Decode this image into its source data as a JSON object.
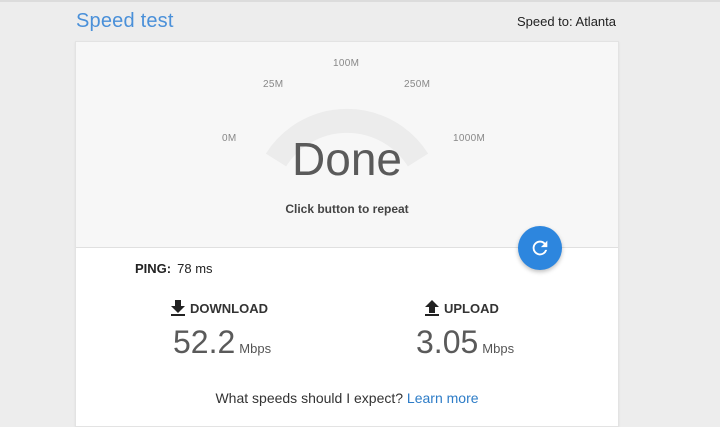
{
  "header": {
    "title": "Speed test",
    "server_label": "Speed to: Atlanta"
  },
  "gauge": {
    "ticks": [
      "0M",
      "25M",
      "100M",
      "250M",
      "1000M"
    ],
    "status": "Done",
    "hint": "Click button to repeat"
  },
  "repeat_button": {
    "icon": "refresh-icon",
    "color": "#2d86de"
  },
  "ping": {
    "label": "PING:",
    "value": "78 ms"
  },
  "download": {
    "label": "DOWNLOAD",
    "icon": "download-arrow-icon",
    "value": "52.2",
    "unit": "Mbps"
  },
  "upload": {
    "label": "UPLOAD",
    "icon": "upload-arrow-icon",
    "value": "3.05",
    "unit": "Mbps"
  },
  "footer": {
    "question": "What speeds should I expect?",
    "link": "Learn more"
  },
  "colors": {
    "title": "#4a90d9",
    "link": "#2d7cc7",
    "accent": "#2d86de"
  }
}
